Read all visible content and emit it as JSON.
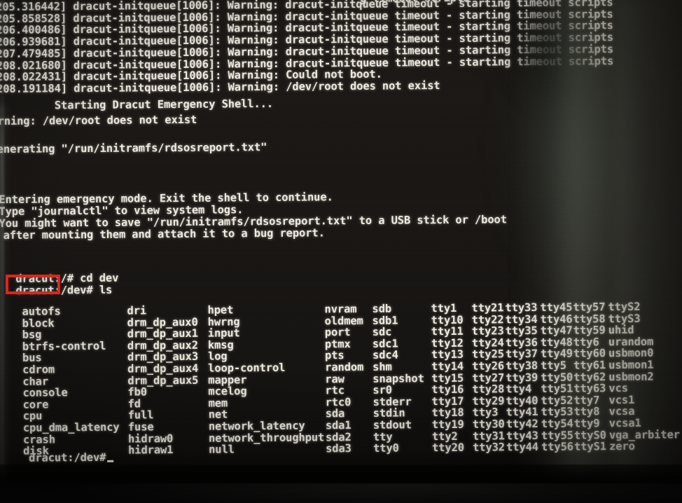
{
  "screen": {
    "kind": "linux-console-dracut-emergency-shell",
    "colors": {
      "background": "#16130f",
      "text": "#efece3",
      "annotation": "#e2231a"
    }
  },
  "boot_log": {
    "partial_top_line": "                                                        g timeout scripts",
    "entries": [
      {
        "timestamp": "205.316442",
        "unit": "dracut-initqueue[1006]",
        "level": "Warning",
        "message": "dracut-initqueue timeout - starting timeout scripts"
      },
      {
        "timestamp": "205.858528",
        "unit": "dracut-initqueue[1006]",
        "level": "Warning",
        "message": "dracut-initqueue timeout - starting timeout scripts"
      },
      {
        "timestamp": "206.400486",
        "unit": "dracut-initqueue[1006]",
        "level": "Warning",
        "message": "dracut-initqueue timeout - starting timeout scripts"
      },
      {
        "timestamp": "206.939681",
        "unit": "dracut-initqueue[1006]",
        "level": "Warning",
        "message": "dracut-initqueue timeout - starting timeout scripts"
      },
      {
        "timestamp": "207.479485",
        "unit": "dracut-initqueue[1006]",
        "level": "Warning",
        "message": "dracut-initqueue timeout - starting timeout scripts"
      },
      {
        "timestamp": "208.021680",
        "unit": "dracut-initqueue[1006]",
        "level": "Warning",
        "message": "dracut-initqueue timeout - starting timeout scripts"
      },
      {
        "timestamp": "208.022431",
        "unit": "dracut-initqueue[1006]",
        "level": "Warning",
        "message": "Could not boot."
      },
      {
        "timestamp": "208.191184",
        "unit": "dracut-initqueue[1006]",
        "level": "Warning",
        "message": "/dev/root does not exist"
      }
    ],
    "lines_rendered": [
      "205.316442] dracut-initqueue[1006]: Warning: dracut-initqueue timeout - starting timeout scripts",
      "205.858528] dracut-initqueue[1006]: Warning: dracut-initqueue timeout - starting timeout scripts",
      "206.400486] dracut-initqueue[1006]: Warning: dracut-initqueue timeout - starting timeout scripts",
      "206.939681] dracut-initqueue[1006]: Warning: dracut-initqueue timeout - starting timeout scripts",
      "207.479485] dracut-initqueue[1006]: Warning: dracut-initqueue timeout - starting timeout scripts",
      "208.021680] dracut-initqueue[1006]: Warning: dracut-initqueue timeout - starting timeout scripts",
      "208.022431] dracut-initqueue[1006]: Warning: Could not boot.",
      "208.191184] dracut-initqueue[1006]: Warning: /dev/root does not exist"
    ],
    "starting_shell": "         Starting Dracut Emergency Shell...",
    "warning_root": "arning: /dev/root does not exist",
    "generating_report": "enerating \"/run/initramfs/rdsosreport.txt\""
  },
  "emergency_notice": {
    "line1": "Entering emergency mode. Exit the shell to continue.",
    "line2": "Type \"journalctl\" to view system logs.",
    "line3": "You might want to save \"/run/initramfs/rdsosreport.txt\" to a USB stick or /boot",
    "line4": "after mounting them and attach it to a bug report."
  },
  "shell": {
    "prompt_root": "dracut:/#",
    "prompt_dev": "dracut:/dev#",
    "command_1": "cd dev",
    "command_2": "ls",
    "final_prompt": "dracut:/dev#",
    "cursor": "_",
    "line_cd": " dracut:/# cd dev",
    "line_ls": " dracut:/dev# ls",
    "line_final": "  dracut:/dev# "
  },
  "annotation": {
    "label": "red-highlight-on-prompt",
    "target_text": "dracut:",
    "color": "#e2231a"
  },
  "dev_listing": {
    "columns": [
      [
        "autofs",
        "block",
        "bsg",
        "btrfs-control",
        "bus",
        "cdrom",
        "char",
        "console",
        "core",
        "cpu",
        "cpu_dma_latency",
        "crash",
        "disk"
      ],
      [
        "dri",
        "drm_dp_aux0",
        "drm_dp_aux1",
        "drm_dp_aux2",
        "drm_dp_aux3",
        "drm_dp_aux4",
        "drm_dp_aux5",
        "fb0",
        "fd",
        "full",
        "fuse",
        "hidraw0",
        "hidraw1"
      ],
      [
        "hpet",
        "hwrng",
        "input",
        "kmsg",
        "log",
        "loop-control",
        "mapper",
        "mcelog",
        "mem",
        "net",
        "network_latency",
        "network_throughput",
        "null"
      ],
      [
        "nvram",
        "oldmem",
        "port",
        "ptmx",
        "pts",
        "random",
        "raw",
        "rtc",
        "rtc0",
        "sda",
        "sda1",
        "sda2",
        "sda3"
      ],
      [
        "sdb",
        "sdb1",
        "sdc",
        "sdc1",
        "sdc4",
        "shm",
        "snapshot",
        "sr0",
        "stderr",
        "stdin",
        "stdout",
        "tty",
        "tty0"
      ],
      [
        "tty1",
        "tty10",
        "tty11",
        "tty12",
        "tty13",
        "tty14",
        "tty15",
        "tty16",
        "tty17",
        "tty18",
        "tty19",
        "tty2",
        "tty20"
      ],
      [
        "tty21",
        "tty22",
        "tty23",
        "tty24",
        "tty25",
        "tty26",
        "tty27",
        "tty28",
        "tty29",
        "tty3",
        "tty30",
        "tty31",
        "tty32"
      ],
      [
        "tty33",
        "tty34",
        "tty35",
        "tty36",
        "tty37",
        "tty38",
        "tty39",
        "tty4",
        "tty40",
        "tty41",
        "tty42",
        "tty43",
        "tty44"
      ],
      [
        "tty45",
        "tty46",
        "tty47",
        "tty48",
        "tty49",
        "tty5",
        "tty50",
        "tty51",
        "tty52",
        "tty53",
        "tty54",
        "tty55",
        "tty56"
      ],
      [
        "tty57",
        "tty58",
        "tty59",
        "tty6",
        "tty60",
        "tty61",
        "tty62",
        "tty63",
        "tty7",
        "tty8",
        "tty9",
        "ttyS0",
        "ttyS1"
      ],
      [
        "ttyS2",
        "ttyS3",
        "uhid",
        "urandom",
        "usbmon0",
        "usbmon1",
        "usbmon2",
        "vcs",
        "vcs1",
        "vcsa",
        "vcsa1",
        "vga_arbiter",
        "zero"
      ]
    ],
    "column_x": [
      28,
      178,
      293,
      460,
      528,
      612,
      670,
      718,
      768,
      815,
      865
    ]
  }
}
